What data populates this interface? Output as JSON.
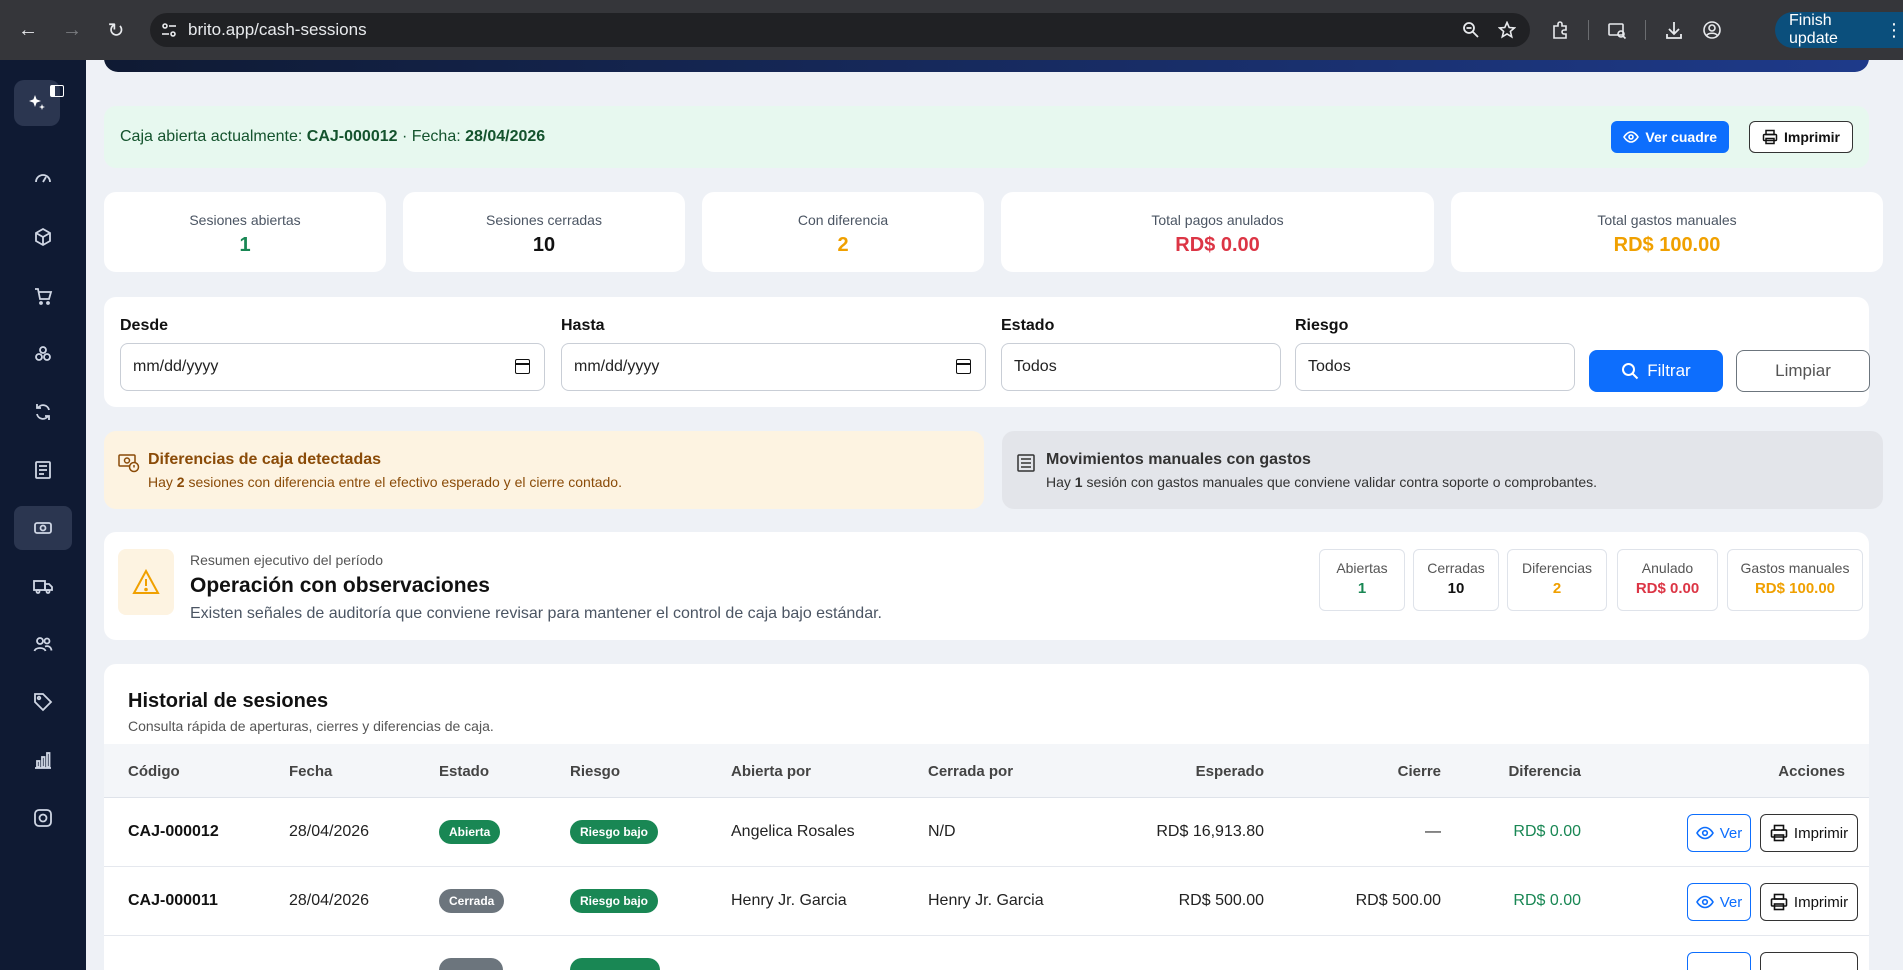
{
  "browser": {
    "url": "brito.app/cash-sessions",
    "update_label": "Finish update"
  },
  "open_session": {
    "prefix": "Caja abierta actualmente:",
    "code": "CAJ-000012",
    "date_prefix": "· Fecha:",
    "date": "28/04/2026",
    "view_label": "Ver cuadre",
    "print_label": "Imprimir"
  },
  "stats": [
    {
      "label": "Sesiones abiertas",
      "value": "1",
      "color": "#198754"
    },
    {
      "label": "Sesiones cerradas",
      "value": "10",
      "color": "#111111"
    },
    {
      "label": "Con diferencia",
      "value": "2",
      "color": "#f0a000"
    },
    {
      "label": "Total pagos anulados",
      "value": "RD$ 0.00",
      "color": "#dc3545"
    },
    {
      "label": "Total gastos manuales",
      "value": "RD$ 100.00",
      "color": "#f0a000"
    }
  ],
  "filters": {
    "desde_label": "Desde",
    "desde_placeholder": "mm/dd/yyyy",
    "hasta_label": "Hasta",
    "hasta_placeholder": "mm/dd/yyyy",
    "estado_label": "Estado",
    "estado_value": "Todos",
    "riesgo_label": "Riesgo",
    "riesgo_value": "Todos",
    "filter_label": "Filtrar",
    "clear_label": "Limpiar"
  },
  "alerts": {
    "differences": {
      "title": "Diferencias de caja detectadas",
      "text_a": "Hay",
      "count": "2",
      "text_b": "sesiones con diferencia entre el efectivo esperado y el cierre contado."
    },
    "manual": {
      "title": "Movimientos manuales con gastos",
      "text_a": "Hay",
      "count": "1",
      "text_b": "sesión con gastos manuales que conviene validar contra soporte o comprobantes."
    }
  },
  "summary": {
    "kicker": "Resumen ejecutivo del período",
    "title": "Operación con observaciones",
    "description": "Existen señales de auditoría que conviene revisar para mantener el control de caja bajo estándar.",
    "metrics": [
      {
        "label": "Abiertas",
        "value": "1",
        "color": "#198754"
      },
      {
        "label": "Cerradas",
        "value": "10",
        "color": "#111111"
      },
      {
        "label": "Diferencias",
        "value": "2",
        "color": "#f0a000"
      },
      {
        "label": "Anulado",
        "value": "RD$ 0.00",
        "color": "#dc3545"
      },
      {
        "label": "Gastos manuales",
        "value": "RD$ 100.00",
        "color": "#f0a000"
      }
    ]
  },
  "history": {
    "title": "Historial de sesiones",
    "subtitle": "Consulta rápida de aperturas, cierres y diferencias de caja.",
    "columns": [
      "Código",
      "Fecha",
      "Estado",
      "Riesgo",
      "Abierta por",
      "Cerrada por",
      "Esperado",
      "Cierre",
      "Diferencia",
      "Acciones"
    ],
    "rows": [
      {
        "code": "CAJ-000012",
        "date": "28/04/2026",
        "status": "Abierta",
        "status_color": "#198754",
        "risk": "Riesgo bajo",
        "opened_by": "Angelica Rosales",
        "closed_by": "N/D",
        "expected": "RD$ 16,913.80",
        "closing": "—",
        "difference": "RD$ 0.00",
        "view": "Ver",
        "print": "Imprimir"
      },
      {
        "code": "CAJ-000011",
        "date": "28/04/2026",
        "status": "Cerrada",
        "status_color": "#6c757d",
        "risk": "Riesgo bajo",
        "opened_by": "Henry Jr. Garcia",
        "closed_by": "Henry Jr. Garcia",
        "expected": "RD$ 500.00",
        "closing": "RD$ 500.00",
        "difference": "RD$ 0.00",
        "view": "Ver",
        "print": "Imprimir"
      }
    ]
  },
  "sidebar": {
    "icons": [
      "dashboard-icon",
      "box-icon",
      "cart-icon",
      "modules-icon",
      "sync-icon",
      "report-icon",
      "cash-icon",
      "truck-icon",
      "users-icon",
      "tag-icon",
      "chart-icon",
      "settings-icon"
    ]
  }
}
